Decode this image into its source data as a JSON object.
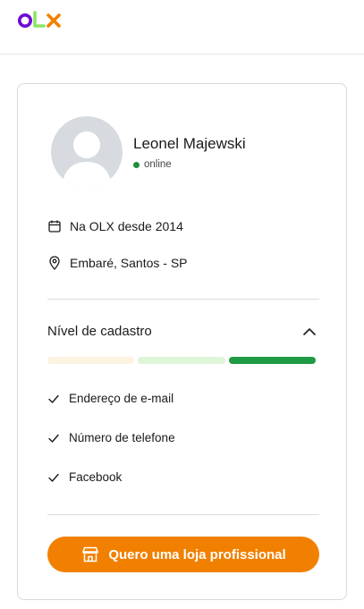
{
  "brand": {
    "logo_text": "OLX",
    "colors": {
      "purple": "#6e0ad6",
      "green": "#8ce563",
      "orange": "#f28000"
    }
  },
  "profile": {
    "name": "Leonel Majewski",
    "status": "online",
    "member_since": "Na OLX desde 2014",
    "location": "Embaré, Santos - SP"
  },
  "level": {
    "title": "Nível de cadastro",
    "progress_segments": [
      {
        "color": "#fdf3e1"
      },
      {
        "color": "#dff5d8"
      },
      {
        "color": "#1f9a45"
      }
    ],
    "verified_items": [
      "Endereço de e-mail",
      "Número de telefone",
      "Facebook"
    ]
  },
  "cta": {
    "label": "Quero uma loja profissional",
    "icon": "store-icon"
  }
}
